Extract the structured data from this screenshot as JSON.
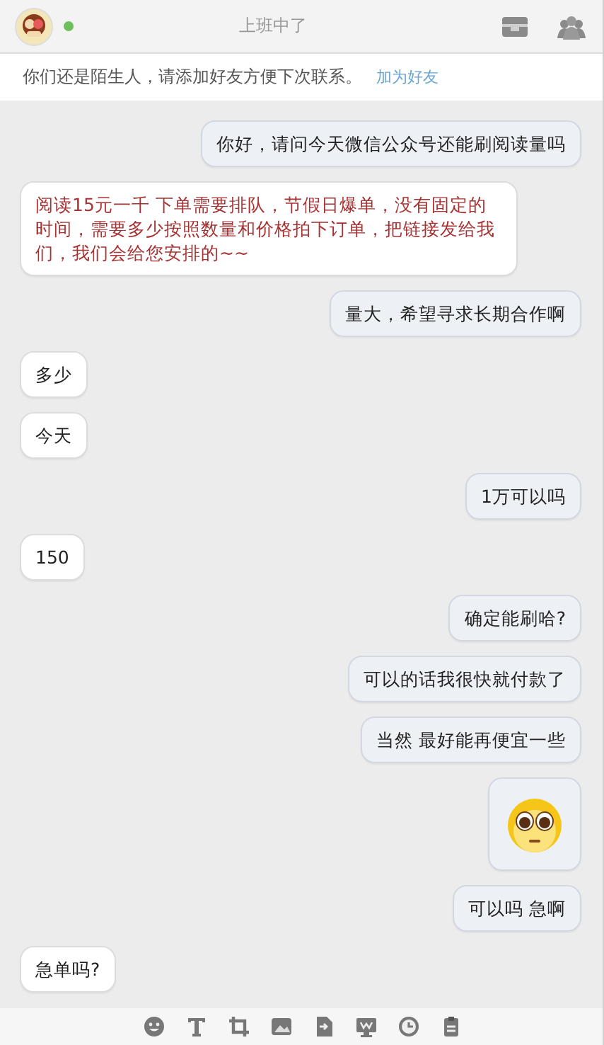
{
  "header": {
    "status": "上班中了",
    "online": true
  },
  "notice": {
    "text": "你们还是陌生人，请添加好友方便下次联系。",
    "link": "加为好友"
  },
  "messages": [
    {
      "mine": true,
      "kind": "text",
      "text": "你好，请问今天微信公众号还能刷阅读量吗",
      "color": "#222222"
    },
    {
      "mine": false,
      "kind": "text",
      "text": "阅读15元一千 下单需要排队，节假日爆单，没有固定的时间，需要多少按照数量和价格拍下订单，把链接发给我们，我们会给您安排的~~",
      "color": "#a83232"
    },
    {
      "mine": true,
      "kind": "text",
      "text": "量大，希望寻求长期合作啊",
      "color": "#222222"
    },
    {
      "mine": false,
      "kind": "text",
      "text": "多少",
      "color": "#222222"
    },
    {
      "mine": false,
      "kind": "text",
      "text": "今天",
      "color": "#222222"
    },
    {
      "mine": true,
      "kind": "text",
      "text": "1万可以吗",
      "color": "#222222"
    },
    {
      "mine": false,
      "kind": "text",
      "text": "150",
      "color": "#222222"
    },
    {
      "mine": true,
      "kind": "text",
      "text": "确定能刷哈?",
      "color": "#222222"
    },
    {
      "mine": true,
      "kind": "text",
      "text": "可以的话我很快就付款了",
      "color": "#222222"
    },
    {
      "mine": true,
      "kind": "text",
      "text": "当然 最好能再便宜一些",
      "color": "#222222"
    },
    {
      "mine": true,
      "kind": "sticker"
    },
    {
      "mine": true,
      "kind": "text",
      "text": "可以吗 急啊",
      "color": "#222222"
    },
    {
      "mine": false,
      "kind": "text",
      "text": "急单吗?",
      "color": "#222222"
    }
  ],
  "toolbar": [
    {
      "kind": "emoji"
    },
    {
      "kind": "text"
    },
    {
      "kind": "crop"
    },
    {
      "kind": "image"
    },
    {
      "kind": "file"
    },
    {
      "kind": "screen"
    },
    {
      "kind": "history"
    },
    {
      "kind": "notes"
    }
  ]
}
